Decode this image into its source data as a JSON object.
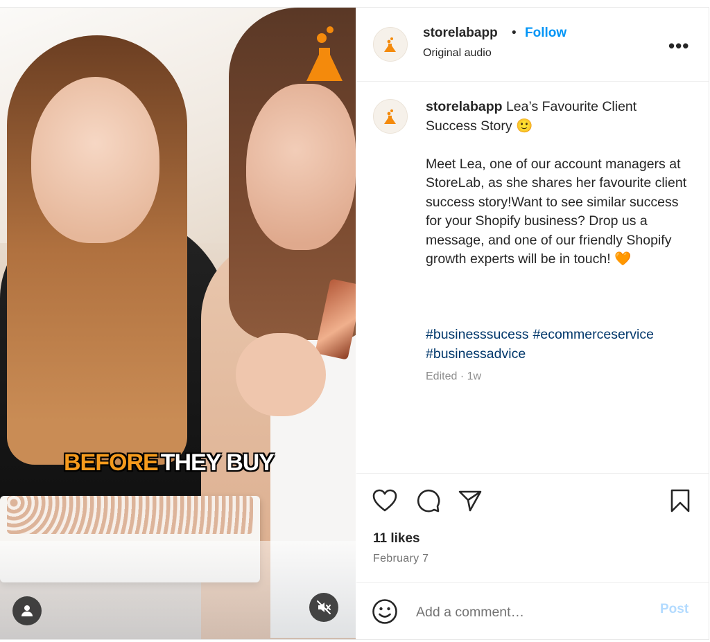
{
  "media": {
    "overlay_text": {
      "highlight": "BEFORE",
      "rest": "THEY BUY"
    },
    "brand_color": "#f48a0c",
    "icons": {
      "logo": "flask-icon",
      "user": "user-icon",
      "mute": "volume-muted-icon"
    }
  },
  "header": {
    "username": "storelabapp",
    "separator": "•",
    "follow_label": "Follow",
    "subtitle": "Original audio",
    "more_label": "•••"
  },
  "caption": {
    "username": "storelabapp",
    "title": "Lea’s Favourite Client Success Story 🙂",
    "body": "Meet Lea, one of our account managers at StoreLab, as she shares her favourite client success story!Want to see similar success for your Shopify business? Drop us a message, and one of our friendly Shopify growth experts will be in touch! 🧡",
    "hashtags": [
      "#businesssucess",
      "#ecommerceservice",
      "#businessadvice"
    ],
    "meta": "Edited · 1w"
  },
  "actions": {
    "icons": [
      "heart-icon",
      "comment-icon",
      "share-icon",
      "bookmark-icon"
    ],
    "likes": "11 likes",
    "date": "February 7"
  },
  "comment": {
    "placeholder": "Add a comment…",
    "post_label": "Post"
  },
  "colors": {
    "link": "#0095f6",
    "hashtag": "#00376b",
    "muted": "#737373"
  }
}
